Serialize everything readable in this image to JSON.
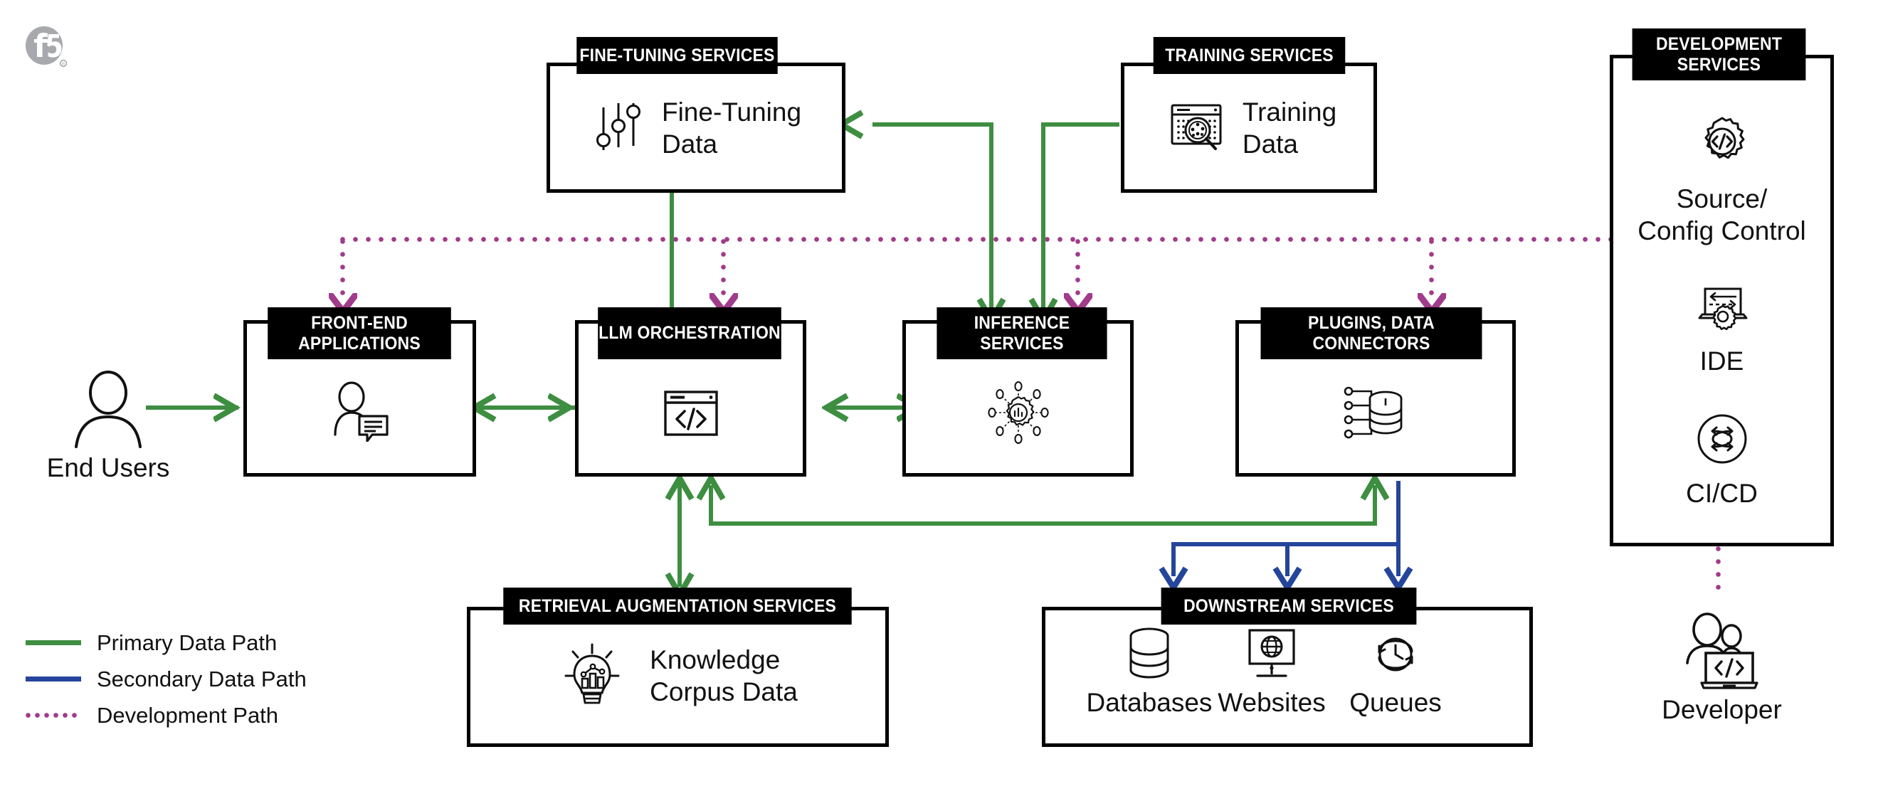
{
  "brand": {
    "logo": "f5-logo",
    "logo_text": "f5"
  },
  "actors": [
    {
      "id": "end-users",
      "label": "End Users",
      "icon": "person-icon"
    },
    {
      "id": "developer",
      "label": "Developer",
      "icon": "developer-laptop-icon"
    }
  ],
  "boxes": [
    {
      "id": "fine-tuning-services",
      "header": "FINE-TUNING SERVICES",
      "items": [
        {
          "label": "Fine-Tuning\nData",
          "icon": "sliders-icon"
        }
      ]
    },
    {
      "id": "training-services",
      "header": "TRAINING SERVICES",
      "items": [
        {
          "label": "Training\nData",
          "icon": "data-analysis-icon"
        }
      ]
    },
    {
      "id": "development-services",
      "header": "DEVELOPMENT\nSERVICES",
      "items": [
        {
          "label": "Source/\nConfig Control",
          "icon": "gear-code-icon"
        },
        {
          "label": "IDE",
          "icon": "ide-laptop-gear-icon"
        },
        {
          "label": "CI/CD",
          "icon": "cicd-cycle-icon"
        }
      ]
    },
    {
      "id": "front-end-applications",
      "header": "FRONT-END\nAPPLICATIONS",
      "items": [
        {
          "label": "",
          "icon": "user-chat-icon"
        }
      ]
    },
    {
      "id": "llm-orchestration",
      "header": "LLM\nORCHESTRATION",
      "items": [
        {
          "label": "",
          "icon": "code-window-icon"
        }
      ]
    },
    {
      "id": "inference-services",
      "header": "INFERENCE\nSERVICES",
      "items": [
        {
          "label": "",
          "icon": "gear-network-icon"
        }
      ]
    },
    {
      "id": "plugins-data-connectors",
      "header": "PLUGINS,\nDATA CONNECTORS",
      "items": [
        {
          "label": "",
          "icon": "database-connector-icon"
        }
      ]
    },
    {
      "id": "retrieval-augmentation-services",
      "header": "RETRIEVAL AUGMENTATION SERVICES",
      "items": [
        {
          "label": "Knowledge\nCorpus Data",
          "icon": "lightbulb-chart-icon"
        }
      ]
    },
    {
      "id": "downstream-services",
      "header": "DOWNSTREAM SERVICES",
      "items": [
        {
          "label": "Databases",
          "icon": "database-icon"
        },
        {
          "label": "Websites",
          "icon": "monitor-globe-icon"
        },
        {
          "label": "Queues",
          "icon": "clock-cycle-icon"
        }
      ]
    }
  ],
  "legend": {
    "items": [
      {
        "label": "Primary Data Path",
        "style": "solid",
        "color": "#3E8E41"
      },
      {
        "label": "Secondary Data Path",
        "style": "solid",
        "color": "#24459B"
      },
      {
        "label": "Development Path",
        "style": "dotted",
        "color": "#A13B8B"
      }
    ]
  },
  "colors": {
    "primary_path": "#3E8E41",
    "secondary_path": "#24459B",
    "development_path": "#A13B8B",
    "box_border": "#000000",
    "header_bg": "#000000",
    "header_text": "#FFFFFF"
  }
}
